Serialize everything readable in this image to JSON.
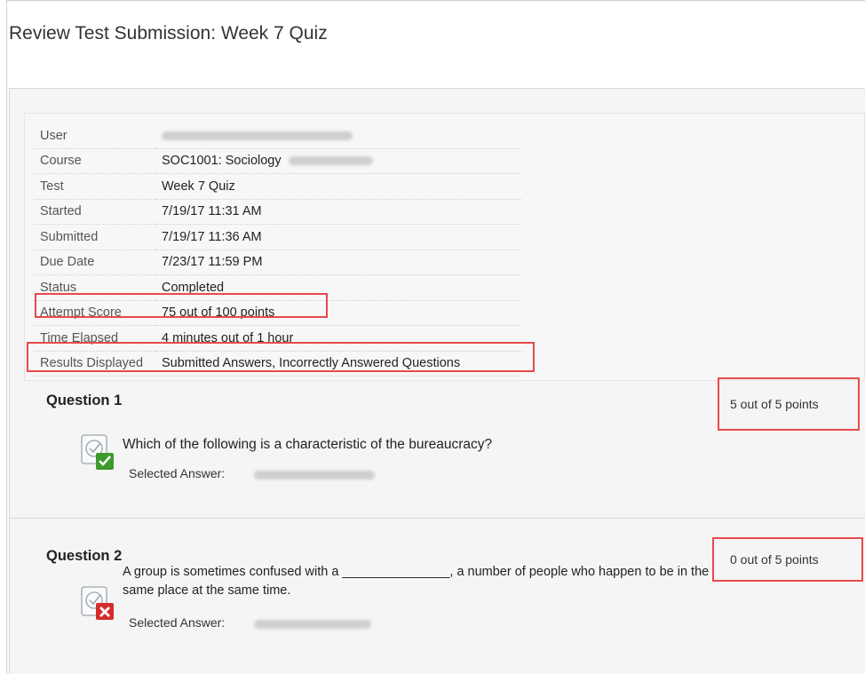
{
  "page_title": "Review Test Submission: Week 7 Quiz",
  "details": [
    {
      "label": "User",
      "value": "",
      "blurred": true,
      "blur_width": 215
    },
    {
      "label": "Course",
      "value": "SOC1001: Sociology",
      "blurred_suffix": true,
      "blur_width": 95
    },
    {
      "label": "Test",
      "value": "Week 7 Quiz"
    },
    {
      "label": "Started",
      "value": "7/19/17 11:31 AM"
    },
    {
      "label": "Submitted",
      "value": "7/19/17 11:36 AM"
    },
    {
      "label": "Due Date",
      "value": "7/23/17 11:59 PM"
    },
    {
      "label": "Status",
      "value": "Completed"
    },
    {
      "label": "Attempt Score",
      "value": "75 out of 100 points"
    },
    {
      "label": "Time Elapsed",
      "value": "4 minutes out of 1 hour"
    },
    {
      "label": "Results Displayed",
      "value": "Submitted Answers, Incorrectly Answered Questions"
    }
  ],
  "questions": [
    {
      "title": "Question 1",
      "points": "5 out of 5 points",
      "text": "Which of the following is a characteristic of the bureaucracy?",
      "selected_label": "Selected Answer:",
      "result": "correct",
      "result_icon": "check-icon"
    },
    {
      "title": "Question 2",
      "points": "0 out of 5 points",
      "text_line1": "A group is sometimes confused with a _______________, a number of people who happen to be in the",
      "text_line2": "same place at the same time.",
      "selected_label": "Selected Answer:",
      "result": "incorrect",
      "result_icon": "x-icon"
    }
  ],
  "colors": {
    "highlight": "#e84a4a",
    "correct": "#3d9a2b",
    "incorrect": "#d52b2b"
  }
}
